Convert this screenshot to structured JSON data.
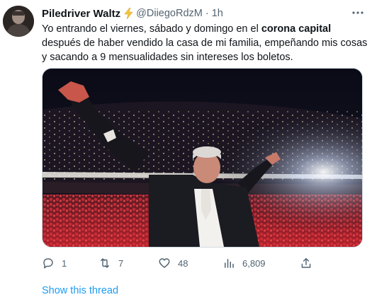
{
  "tweet": {
    "author_name": "Piledriver Waltz",
    "handle": "@DiiegoRdzM",
    "separator": "·",
    "time": "1h",
    "text_part1": "Yo entrando el viernes, sábado y domingo en el ",
    "text_bold": "corona capital",
    "text_part2": " después de haber vendido la casa de mi familia, empeñando mis cosas y sacando a 9 mensualidades sin intereses los boletos.",
    "media_description_icon": "photo",
    "colors": {
      "link": "#1d9bf0",
      "secondary_text": "#536471",
      "verified_bolt": "#f4c542"
    }
  },
  "actions": {
    "reply": {
      "icon": "reply-icon",
      "count": "1"
    },
    "retweet": {
      "icon": "retweet-icon",
      "count": "7"
    },
    "like": {
      "icon": "heart-icon",
      "count": "48"
    },
    "views": {
      "icon": "views-icon",
      "count": "6,809"
    },
    "share": {
      "icon": "share-icon"
    }
  },
  "show_thread": "Show this thread"
}
